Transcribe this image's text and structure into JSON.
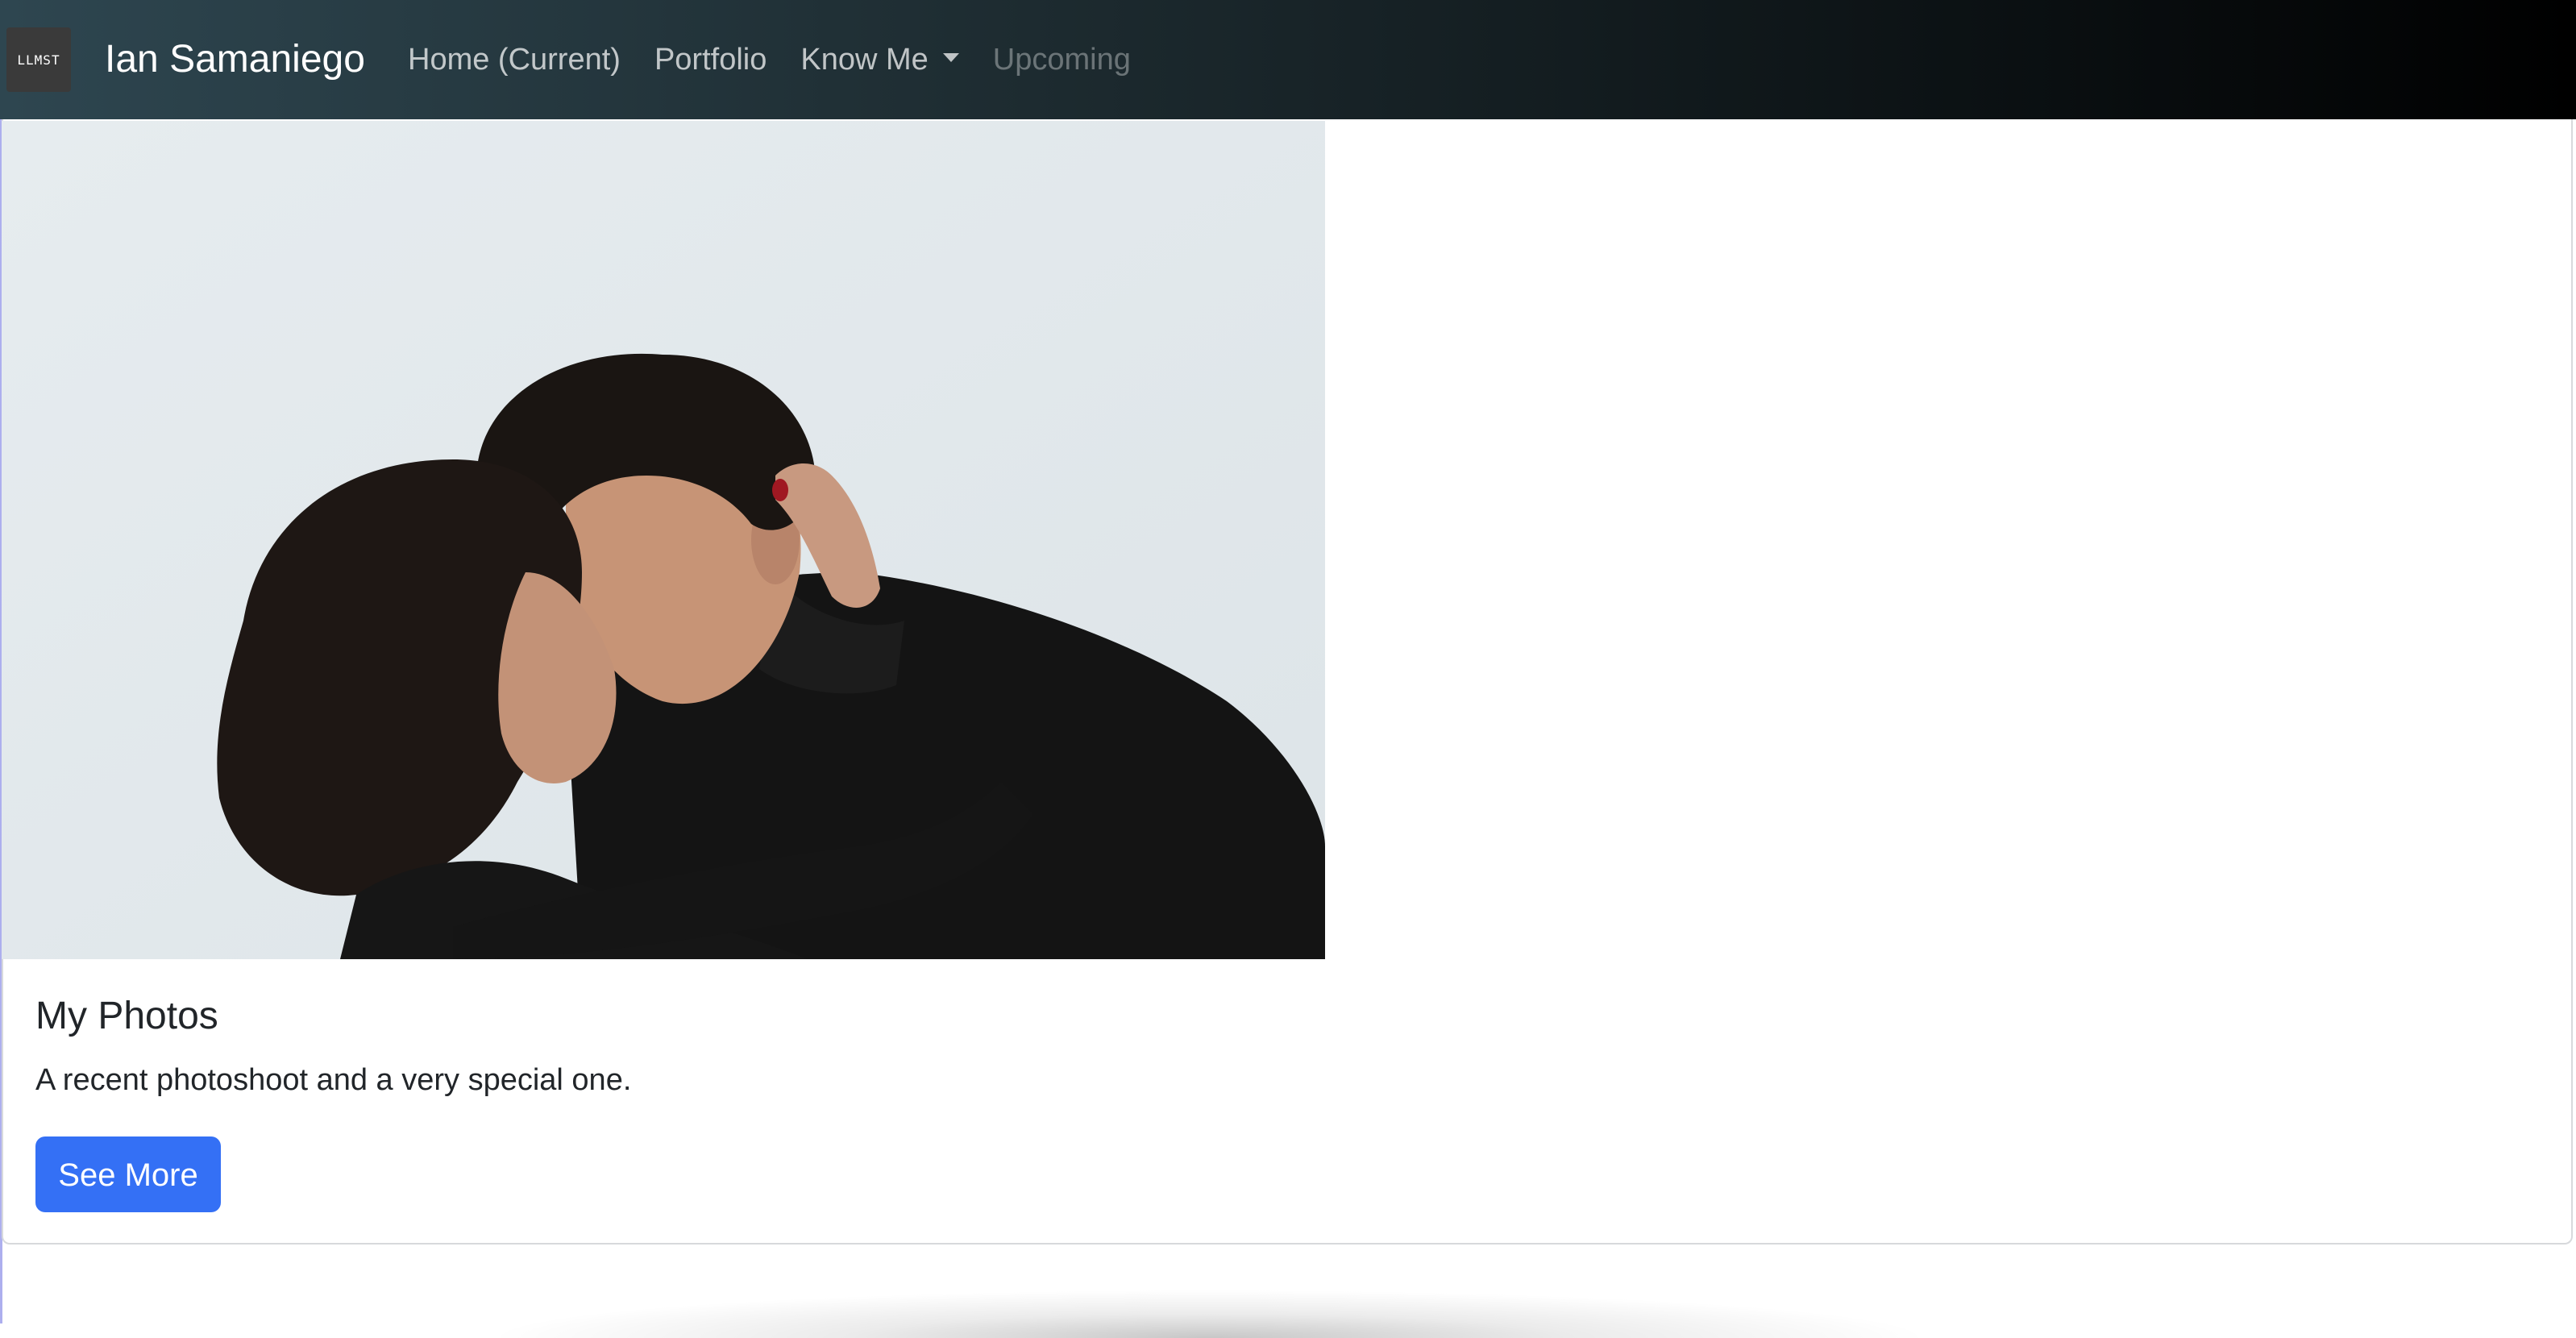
{
  "navbar": {
    "logo_text": "LLMST",
    "brand_name": "Ian Samaniego",
    "links": [
      {
        "label": "Home (Current)",
        "state": "active"
      },
      {
        "label": "Portfolio",
        "state": "normal"
      },
      {
        "label": "Know Me",
        "state": "dropdown"
      },
      {
        "label": "Upcoming",
        "state": "disabled"
      }
    ]
  },
  "card": {
    "image_subject": "couple-photo",
    "title": "My Photos",
    "text": "A recent photoshoot and a very special one.",
    "button_label": "See More"
  },
  "colors": {
    "navbar_dark": "#000000",
    "navbar_teal": "#2e4650",
    "button_primary": "#3470f5",
    "text_dark": "#212529"
  }
}
